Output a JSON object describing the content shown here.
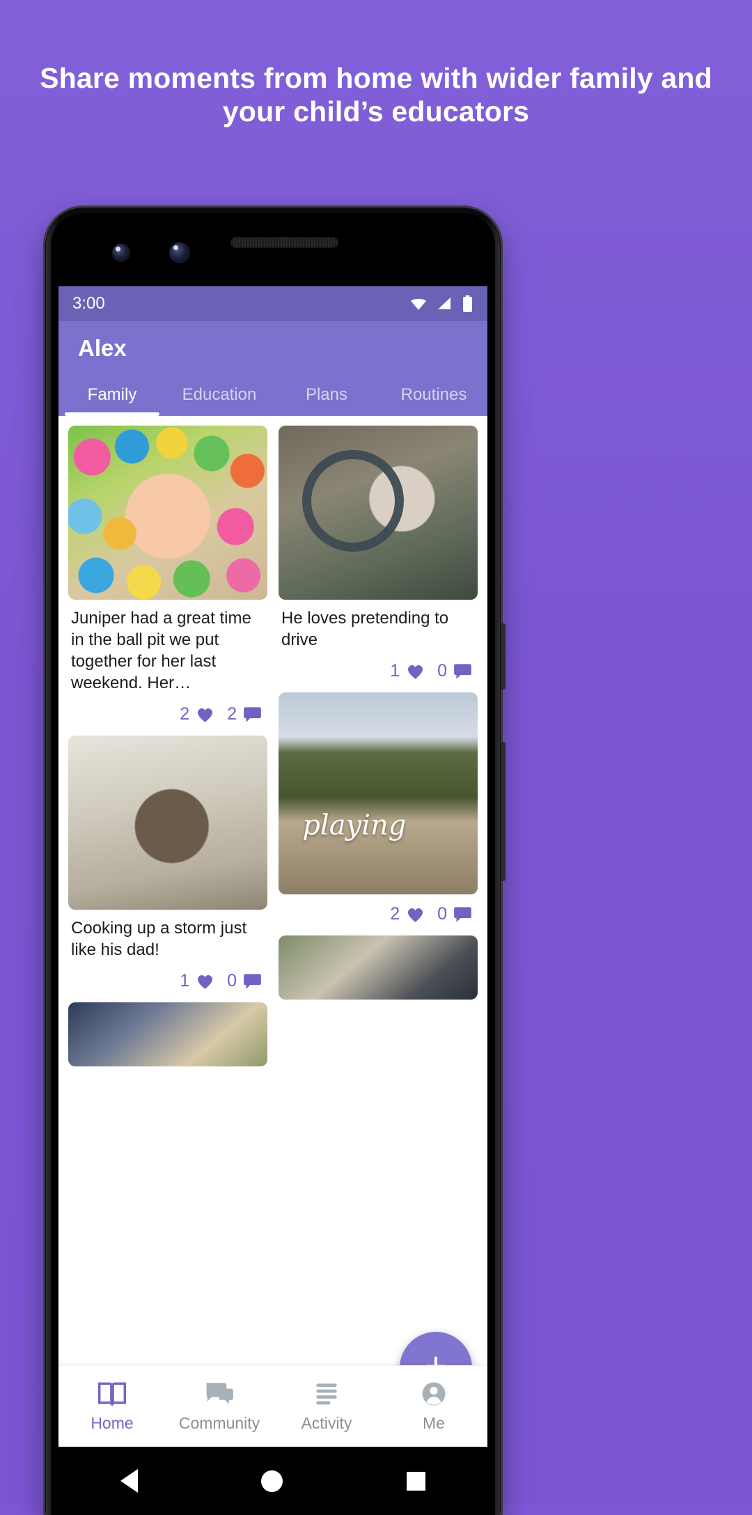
{
  "promo": {
    "headline": "Share moments from home with wider family and your child’s educators",
    "background_color": "#7b56d4"
  },
  "phone": {
    "status_bar": {
      "time": "3:00",
      "icons": [
        "wifi-icon",
        "cell-signal-icon",
        "battery-icon"
      ],
      "background_color": "#6a63b5"
    },
    "app_bar": {
      "title": "Alex",
      "background_color": "#7a72cd",
      "tabs": [
        {
          "label": "Family",
          "active": true
        },
        {
          "label": "Education",
          "active": false
        },
        {
          "label": "Plans",
          "active": false
        },
        {
          "label": "Routines",
          "active": false
        }
      ]
    },
    "feed": {
      "accent_color": "#6f63c4",
      "left_column": [
        {
          "photo": "child-in-ball-pit",
          "caption": "Juniper had a great time in the ball pit we put together for her last weekend. Her…",
          "likes": "2",
          "comments": "2"
        },
        {
          "photo": "toddler-cooking-with-pot",
          "caption": "Cooking up a storm just like his dad!",
          "likes": "1",
          "comments": "0"
        },
        {
          "photo": "child-partial-bottom",
          "caption": "",
          "likes": "",
          "comments": ""
        }
      ],
      "right_column": [
        {
          "photo": "baby-pretending-to-drive",
          "caption": "He loves pretending to drive",
          "likes": "1",
          "comments": "0"
        },
        {
          "photo": "boy-jumping-playing",
          "caption": "",
          "overlay_text": "playing",
          "likes": "2",
          "comments": "0"
        },
        {
          "photo": "two-children-outdoors-partial",
          "caption": "",
          "likes": "",
          "comments": ""
        }
      ],
      "fab": {
        "label": "+",
        "name": "add-post-button",
        "color": "#8075cf"
      }
    },
    "bottom_nav": [
      {
        "label": "Home",
        "icon": "open-book-icon",
        "active": true
      },
      {
        "label": "Community",
        "icon": "speech-bubbles-icon",
        "active": false
      },
      {
        "label": "Activity",
        "icon": "list-lines-icon",
        "active": false
      },
      {
        "label": "Me",
        "icon": "person-circle-icon",
        "active": false
      }
    ],
    "system_nav": [
      "back-triangle-icon",
      "home-circle-icon",
      "recents-square-icon"
    ]
  }
}
